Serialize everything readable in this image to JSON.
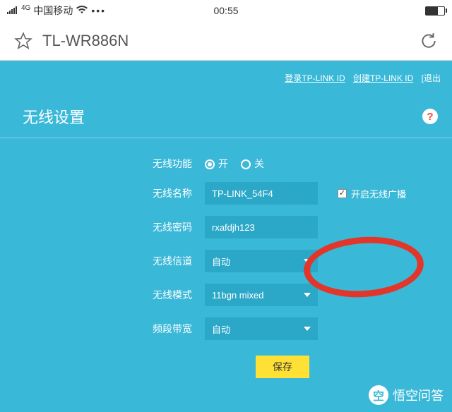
{
  "status": {
    "network_type": "4G",
    "carrier": "中国移动",
    "time": "00:55"
  },
  "url_bar": {
    "title": "TL-WR886N"
  },
  "top_links": {
    "login": "登录TP-LINK ID",
    "create": "创建TP-LINK ID",
    "logout": "[退出"
  },
  "section": {
    "title": "无线设置",
    "help": "?"
  },
  "form": {
    "wireless_enable": {
      "label": "无线功能",
      "on": "开",
      "off": "关",
      "value": "on"
    },
    "ssid": {
      "label": "无线名称",
      "value": "TP-LINK_54F4"
    },
    "broadcast": {
      "label": "开启无线广播",
      "checked": true
    },
    "password": {
      "label": "无线密码",
      "value": "rxafdjh123"
    },
    "channel": {
      "label": "无线信道",
      "value": "自动"
    },
    "mode": {
      "label": "无线模式",
      "value": "11bgn mixed"
    },
    "bandwidth": {
      "label": "频段带宽",
      "value": "自动"
    },
    "save": "保存"
  },
  "watermark": {
    "text": "悟空问答"
  }
}
